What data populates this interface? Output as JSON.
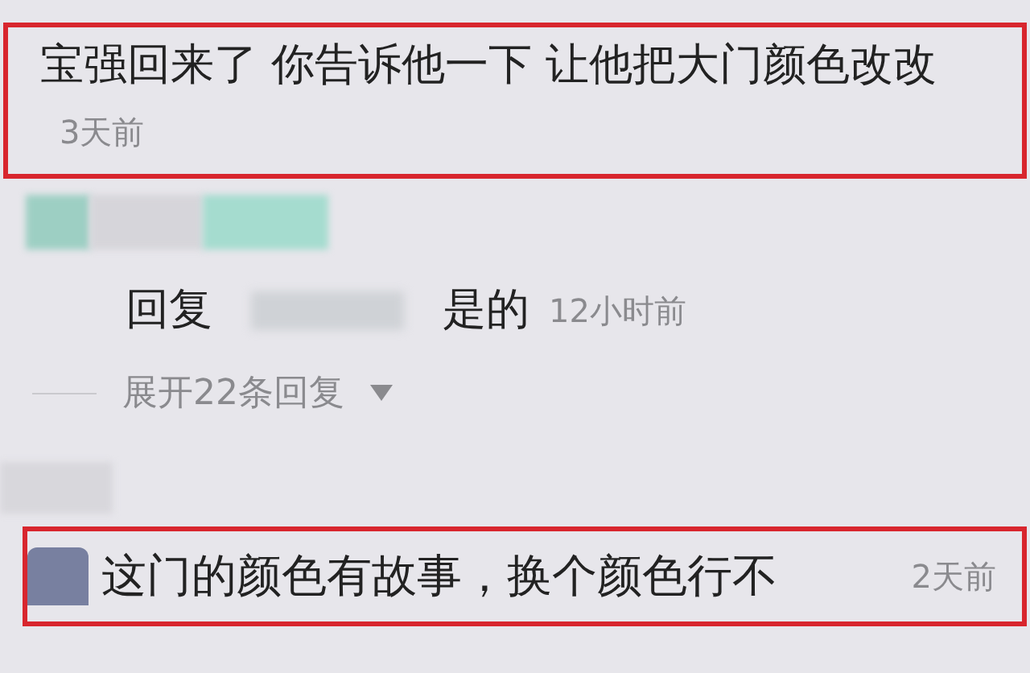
{
  "comment": {
    "text": "宝强回来了 你告诉他一下 让他把大门颜色改改",
    "time": "3天前",
    "highlighted": true
  },
  "reply": {
    "prefix": "回复",
    "text": "是的",
    "time": "12小时前"
  },
  "expand_replies": {
    "label": "展开22条回复",
    "expanded": false
  },
  "second_comment": {
    "text": "这门的颜色有故事，换个颜色行不",
    "time": "2天前",
    "highlighted": true
  }
}
